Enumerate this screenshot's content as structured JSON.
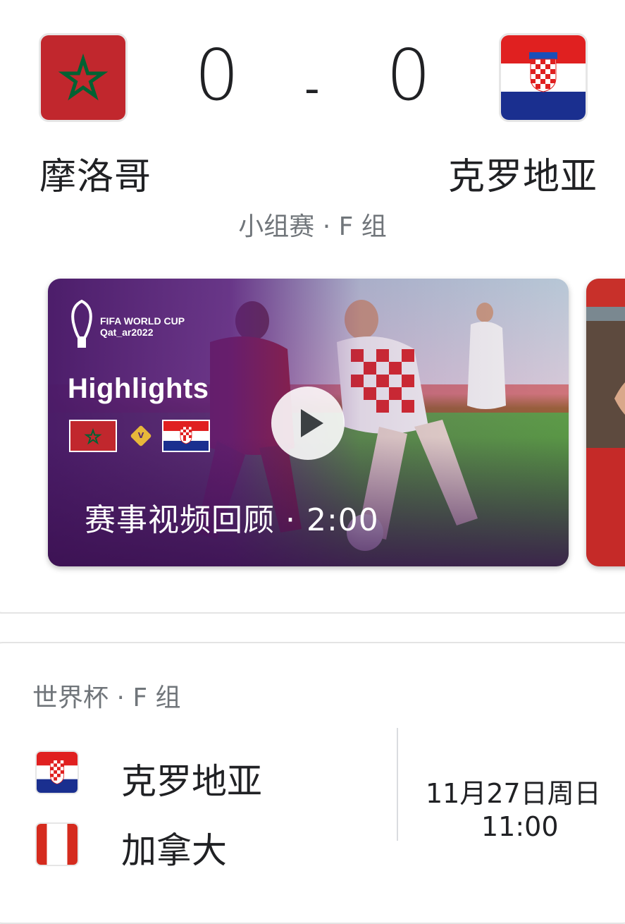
{
  "match": {
    "home_team": "摩洛哥",
    "away_team": "克罗地亚",
    "home_score": "0",
    "away_score": "0",
    "score_separator": "-",
    "stage": "小组赛 · F 组"
  },
  "video": {
    "brand_line1": "FIFA WORLD CUP",
    "brand_line2": "Qat_ar2022",
    "title": "Highlights",
    "vs": "V",
    "caption": "赛事视频回顾 · 2:00"
  },
  "group": {
    "title": "世界杯 · F 组",
    "rows": [
      {
        "team": "克罗地亚"
      },
      {
        "team": "加拿大"
      }
    ],
    "date": "11月27日周日",
    "time": "11:00"
  },
  "colors": {
    "morocco_red": "#c1272d",
    "morocco_green": "#006233",
    "croatia_red": "#e02020",
    "croatia_blue": "#1a2f8f",
    "video_purple": "#4a1a68"
  }
}
